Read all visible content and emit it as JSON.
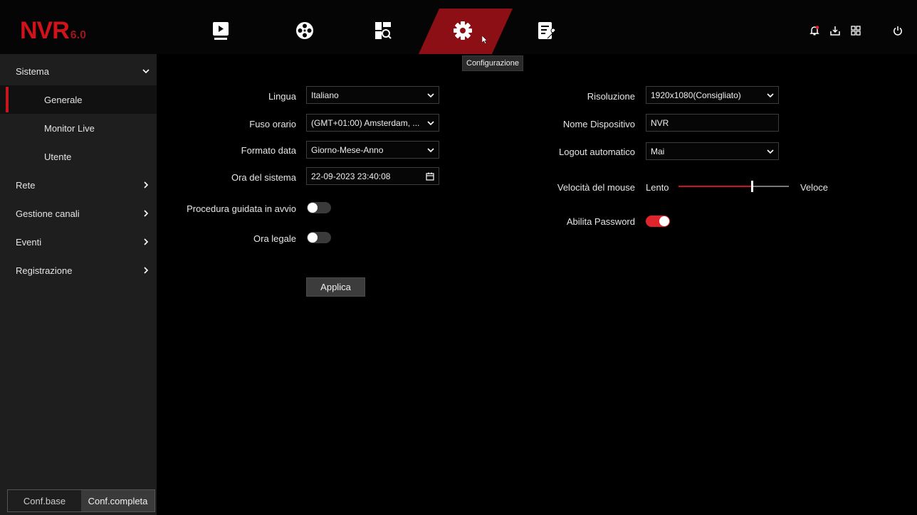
{
  "brand": {
    "name": "NVR",
    "version": "6.0",
    "color": "#d0131b"
  },
  "topnav": {
    "items": [
      {
        "icon": "playback-icon"
      },
      {
        "icon": "reel-icon"
      },
      {
        "icon": "search-icon"
      },
      {
        "icon": "gear-icon",
        "active": true
      },
      {
        "icon": "maintenance-icon"
      }
    ],
    "tooltip": "Configurazione",
    "right_icons": [
      "alarm-bell-icon",
      "download-icon",
      "grid-icon",
      "power-icon"
    ]
  },
  "sidebar": {
    "items": [
      {
        "label": "Sistema",
        "expanded": true
      },
      {
        "label": "Generale",
        "selected": true
      },
      {
        "label": "Monitor Live"
      },
      {
        "label": "Utente"
      },
      {
        "label": "Rete"
      },
      {
        "label": "Gestione canali"
      },
      {
        "label": "Eventi"
      },
      {
        "label": "Registrazione"
      }
    ],
    "mode": {
      "base": "Conf.base",
      "full": "Conf.completa",
      "active": "full"
    }
  },
  "form": {
    "lingua": {
      "label": "Lingua",
      "value": "Italiano"
    },
    "fuso": {
      "label": "Fuso orario",
      "value": "(GMT+01:00) Amsterdam, ..."
    },
    "formato": {
      "label": "Formato data",
      "value": "Giorno-Mese-Anno"
    },
    "ora": {
      "label": "Ora del sistema",
      "value": "22-09-2023 23:40:08"
    },
    "procedura": {
      "label": "Procedura guidata in avvio",
      "enabled": false
    },
    "legale": {
      "label": "Ora legale",
      "enabled": false
    },
    "apply_label": "Applica",
    "risoluzione": {
      "label": "Risoluzione",
      "value": "1920x1080(Consigliato)"
    },
    "nome": {
      "label": "Nome Dispositivo",
      "value": "NVR"
    },
    "logout": {
      "label": "Logout automatico",
      "value": "Mai"
    },
    "mouse": {
      "label": "Velocità del mouse",
      "min_label": "Lento",
      "max_label": "Veloce",
      "level": 0.67
    },
    "password": {
      "label": "Abilita Password",
      "enabled": true
    }
  },
  "colors": {
    "accent": "#c8161e",
    "active_tab": "#8b0f14",
    "sidebar_bg": "#1e1e1e"
  }
}
